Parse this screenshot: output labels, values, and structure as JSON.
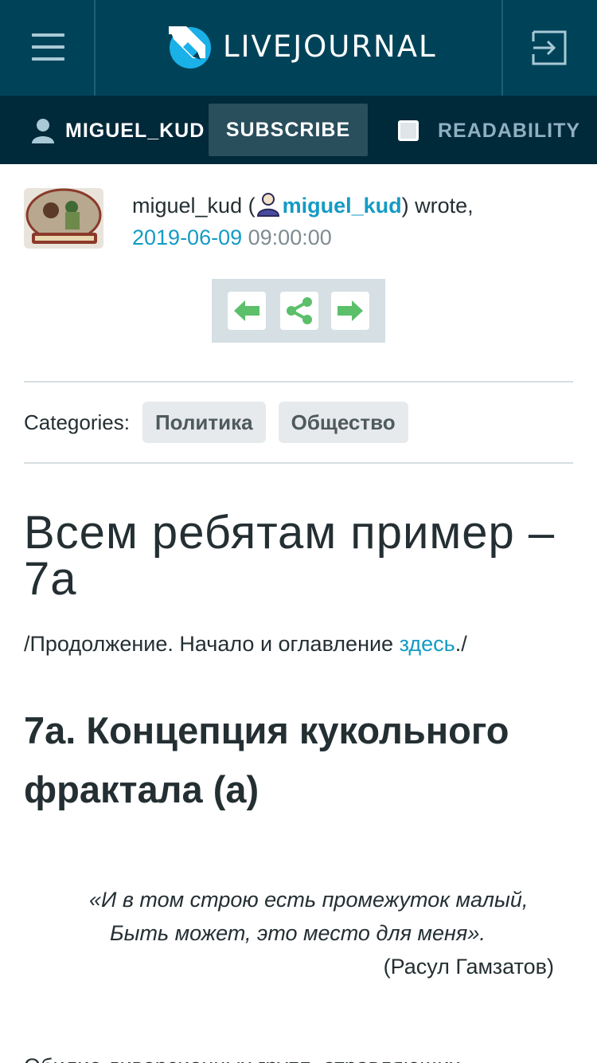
{
  "header": {
    "logo_text": "LIVEJOURNAL",
    "menu_icon": "hamburger-icon",
    "login_icon": "login-icon"
  },
  "userbar": {
    "username": "MIGUEL_KUD",
    "subscribe_label": "SUBSCRIBE",
    "readability_label": "READABILITY"
  },
  "post": {
    "author_prefix": "miguel_kud (",
    "author_ljuser": "miguel_kud",
    "author_suffix": ") wrote,",
    "date": "2019-06-09",
    "time": "09:00:00",
    "categories_label": "Categories:",
    "categories": [
      "Политика",
      "Общество"
    ],
    "title": "Всем ребятам пример – 7а",
    "continuation_prefix": "/Продолжение. Начало и оглавление ",
    "continuation_link": "здесь",
    "continuation_suffix": "./",
    "heading": "7а. Концепция кукольного фрактала (а)",
    "quote_line1": "«И в том строю есть промежуток малый,",
    "quote_line2": "Быть может, это место для меня».",
    "quote_author": "(Расул Гамзатов)",
    "body_start": "Обилие диверсионных групп, отравляющих"
  },
  "colors": {
    "header_bg": "#004359",
    "userbar_bg": "#00293a",
    "link": "#149bc4",
    "nav_arrow": "#5cbf6a"
  }
}
